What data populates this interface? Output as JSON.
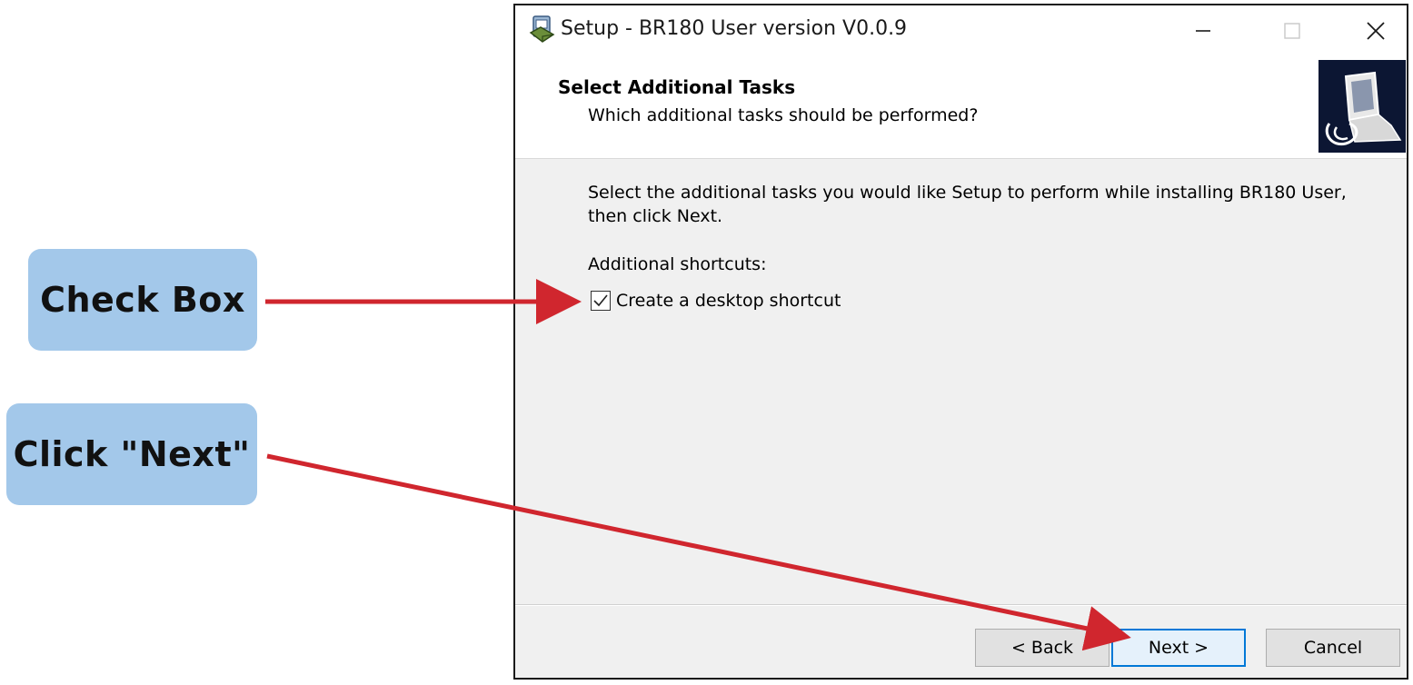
{
  "window": {
    "title": "Setup - BR180 User version V0.0.9",
    "app_icon": "installer-icon",
    "controls": {
      "minimize_icon": "minimize-icon",
      "maximize_icon": "maximize-icon",
      "close_icon": "close-icon"
    }
  },
  "header": {
    "title": "Select Additional Tasks",
    "subtitle": "Which additional tasks should be performed?",
    "logo_icon": "setup-computer-icon"
  },
  "content": {
    "instructions": "Select the additional tasks you would like Setup to perform while installing BR180 User, then click Next.",
    "section_label": "Additional shortcuts:",
    "checkbox": {
      "label": "Create a desktop shortcut",
      "checked": true
    }
  },
  "buttons": {
    "back": "< Back",
    "next": "Next >",
    "cancel": "Cancel"
  },
  "annotations": {
    "check_box": "Check Box",
    "click_next": "Click \"Next\"",
    "arrow_color": "#d0262e",
    "callout_color": "#a3c8ea"
  }
}
